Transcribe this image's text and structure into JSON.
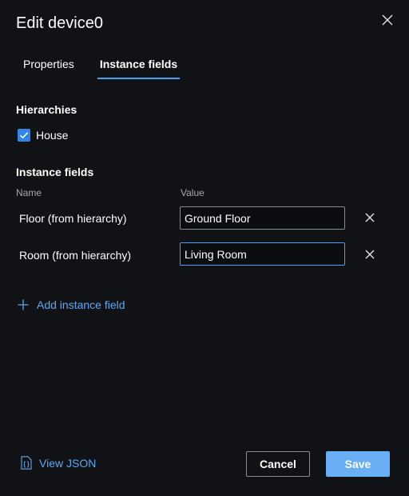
{
  "dialog": {
    "title": "Edit device0"
  },
  "tabs": [
    {
      "label": "Properties",
      "selected": false
    },
    {
      "label": "Instance fields",
      "selected": true
    }
  ],
  "hierarchies": {
    "heading": "Hierarchies",
    "items": [
      {
        "label": "House",
        "checked": true
      }
    ]
  },
  "instance_fields": {
    "heading": "Instance fields",
    "columns": {
      "name": "Name",
      "value": "Value"
    },
    "rows": [
      {
        "name": "Floor (from hierarchy)",
        "value": "Ground Floor"
      },
      {
        "name": "Room (from hierarchy)",
        "value": "Living Room"
      }
    ],
    "add_label": "Add instance field"
  },
  "footer": {
    "view_json_label": "View JSON",
    "cancel_label": "Cancel",
    "save_label": "Save"
  },
  "colors": {
    "background": "#111216",
    "accent": "#4aa0f0",
    "link": "#5aa9f2",
    "primary_button": "#6aaef5",
    "checkbox": "#2f86e6"
  }
}
